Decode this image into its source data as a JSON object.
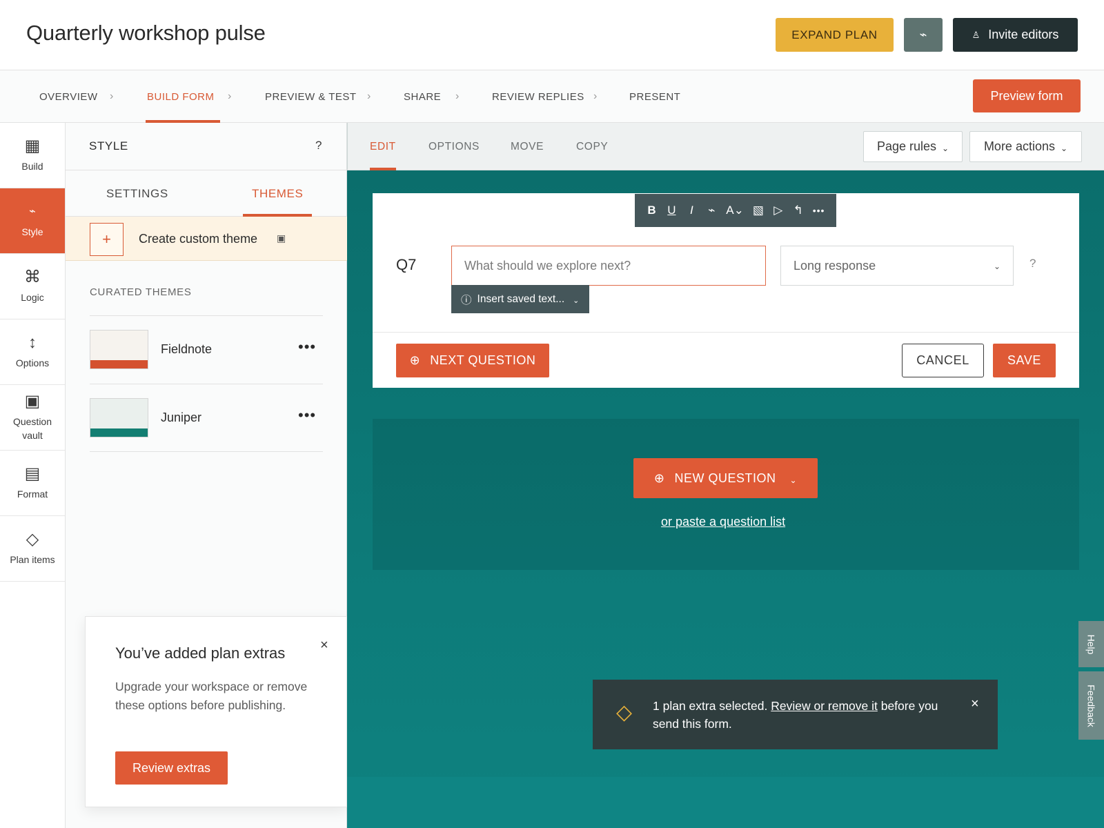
{
  "header": {
    "title": "Quarterly workshop pulse",
    "expand_label": "EXPAND PLAN",
    "bolt_icon": "⌁",
    "invite_icon": "♙",
    "invite_label": "Invite editors"
  },
  "steps": {
    "items": [
      "OVERVIEW",
      "BUILD FORM",
      "PREVIEW & TEST",
      "SHARE",
      "REVIEW REPLIES",
      "PRESENT"
    ],
    "chevron": "›",
    "preview_label": "Preview form"
  },
  "rail": {
    "items": [
      {
        "label": "Build",
        "icon": "▦"
      },
      {
        "label": "Style",
        "icon": "⌁"
      },
      {
        "label": "Logic",
        "icon": "⌘"
      },
      {
        "label": "Options",
        "icon": "↕"
      },
      {
        "label": "Question vault",
        "icon": "▣"
      },
      {
        "label": "Format",
        "icon": "▤"
      },
      {
        "label": "Plan items",
        "icon": "◇"
      }
    ]
  },
  "panel": {
    "title": "STYLE",
    "help": "?",
    "tabs": [
      "SETTINGS",
      "THEMES"
    ],
    "create_plus": "+",
    "create_label": "Create custom theme",
    "create_icon": "▣",
    "curated_title": "CURATED THEMES",
    "themes": [
      {
        "name": "Fieldnote",
        "more": "•••",
        "bg": "#f6f3ee",
        "bar": "#d4512f"
      },
      {
        "name": "Juniper",
        "more": "•••",
        "bg": "#eaf0ed",
        "bar": "#137e72"
      }
    ]
  },
  "extras": {
    "title": "You’ve added plan extras",
    "close": "×",
    "body": "Upgrade your workspace or remove these options before publishing.",
    "button": "Review extras"
  },
  "editor": {
    "tabs": [
      "EDIT",
      "OPTIONS",
      "MOVE",
      "COPY"
    ],
    "page_rules": "Page rules",
    "more_actions": "More actions",
    "chevron": "⌄"
  },
  "toolbar": {
    "items": [
      "B",
      "U",
      "I",
      "⌁",
      "A⌄",
      "▧",
      "▷",
      "↰",
      "•••"
    ]
  },
  "question": {
    "number": "Q7",
    "placeholder": "What should we explore next?",
    "saved_icon": "ⓘ",
    "saved_label": "Insert saved text...",
    "type_label": "Long response",
    "help": "?",
    "plus_icon": "⊕",
    "next_label": "NEXT QUESTION",
    "cancel_label": "CANCEL",
    "save_label": "SAVE"
  },
  "new_question": {
    "label": "NEW QUESTION",
    "paste_link": "or paste a question list"
  },
  "side_tabs": {
    "help": "Help",
    "feedback": "Feedback"
  },
  "toast": {
    "icon": "◇",
    "text_before": "1 plan extra selected. ",
    "link": "Review or remove it",
    "text_after": " before you send this form.",
    "close": "×"
  },
  "colors": {
    "accent": "#df5a36",
    "expand": "#e8b13a",
    "canvas": "#0d7b79",
    "dark": "#233032"
  }
}
